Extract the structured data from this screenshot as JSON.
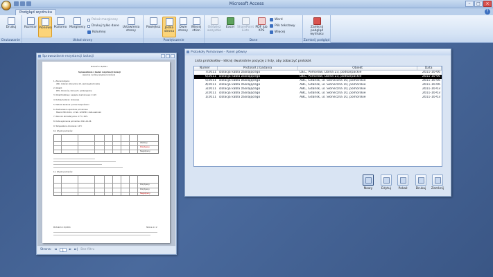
{
  "app": {
    "title": "Microsoft Access"
  },
  "tabs": {
    "active": "Podgląd wydruku"
  },
  "ribbon": {
    "groups": {
      "print": "Drukowanie",
      "page_layout": "Układ strony",
      "zoom": "Powiększenie",
      "data": "Dane",
      "close_preview": "Zamknij podgląd"
    },
    "print_label": "Drukuj",
    "size_label": "Rozmiar",
    "portrait_label": "Pionowa",
    "landscape_label": "Poziomo",
    "margins_label": "Marginesy",
    "show_margins": "Pokaż marginesy",
    "print_data_only": "Drukuj tylko dane",
    "columns": "Kolumny",
    "page_setup": "Ustawienia strony",
    "zoom_label": "Powiększ",
    "one_page": "Jedna strona",
    "two_pages": "Dwie strony",
    "more_pages": "Więcej stron",
    "refresh_all": "Odśwież wszystko",
    "excel": "Excel",
    "sharepoint": "SharePoint Lists",
    "pdf": "PDF lub XPS",
    "word": "Word",
    "text_file": "Plik tekstowy",
    "more": "Więcej",
    "close_preview_btn": "Zamknij podgląd wydruku"
  },
  "report_window": {
    "title": "Sprawozdanie rezystancji izolacji",
    "status_page_label": "Strona:",
    "status_page": "1",
    "status_filter": "Bez filtru",
    "doc": {
      "heading": "Protokół nr 6/2011",
      "subheading": "Sprawozdanie z badań rezystancji izolacji",
      "subheading2": "(zgodnie z próbą rezystancji izolacji)",
      "item1": "1. Zleceniodawca:",
      "item1v": "ABC, Gdańsk, Słoneczna 10, sieciowa/pomorskie",
      "item2": "2. Obiekt:",
      "item2v": "DEC, Pomorów, Dolna 23, podkarpackie",
      "item3": "3. Obiekt kablowy: napięcie znamionowe: 11 kV",
      "item4": "4. Rodzaj badania: okresowe",
      "item5": "5. Metoda badania: pomiar bezpośredni",
      "item6": "6. Zastosowana aparatura pomiarowa:",
      "item6v": "Miernik MIC-10k1, nr fab. 1234567, data ważności",
      "item7": "7. Warunki atmosferyczne: 17°C, 64%",
      "item8": "8. Data wykonania pomiarów: 2011-10-06",
      "item9": "9. Temperatura otoczenia: 14°C",
      "item10": "10. Wyniki pomiarów:",
      "item11": "11. Wyniki pomiarów:",
      "footer_left": "Protokół nr: 6/2011",
      "footer_right": "Strona 1 z 2",
      "t1_status": [
        "Wadliwy",
        "Pozytywny",
        "Negatywny"
      ],
      "t2_status": [
        "Pozytywny",
        "Pozytywny",
        "Negatywny"
      ]
    }
  },
  "form_window": {
    "title": "Protokoły Pomiarowe - Panel główny",
    "instruction": "Lista protokołów - kliknij dwukrotnie pozycję z listy, aby zobaczyć protokół.",
    "columns": [
      "Numer",
      "Protokół z badania",
      "Obiekt",
      "Data"
    ],
    "rows": [
      [
        "7/2011",
        "izolacja kabla zasilającego",
        "DEC, Pomorów, Dolna 23, podkarpackie",
        "2011-10-06"
      ],
      [
        "6/2011",
        "izolacja kabla zasilającego",
        "DEC, Pomorów, Dolna 23, podkarpackie",
        "2011-10-06"
      ],
      [
        "5/2011",
        "izolacja kabla zasilającego",
        "ABC, Gdańsk, ul. Słoneczna 10, pomorskie",
        "2011-10-06"
      ],
      [
        "4/2011",
        "izolacja kabla zasilającego",
        "ABC, Gdańsk, ul. Słoneczna 10, pomorskie",
        "2011-10-06"
      ],
      [
        "3/2011",
        "izolacja kabla zasilającego",
        "ABC, Gdańsk, ul. Słoneczna 10, pomorskie",
        "2011-10-03"
      ],
      [
        "2/2011",
        "izolacja kabla zasilającego",
        "ABC, Gdańsk, ul. Słoneczna 10, pomorskie",
        "2011-10-03"
      ],
      [
        "1/2011",
        "izolacja kabla zasilającego",
        "ABC, Gdańsk, ul. Słoneczna 10, pomorskie",
        "2011-10-03"
      ]
    ],
    "selected_row": 1,
    "buttons": [
      "Nowy",
      "Edytuj",
      "Pokaż",
      "Drukuj",
      "Zamknij"
    ]
  }
}
